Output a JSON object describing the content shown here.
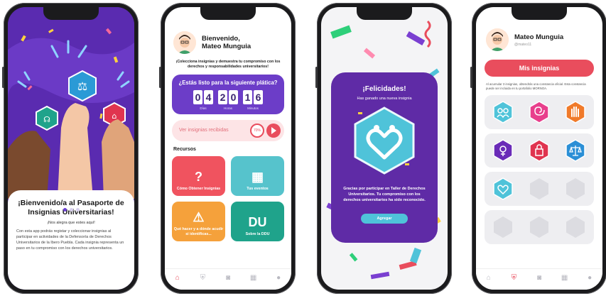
{
  "colors": {
    "purple": "#5a2bb0",
    "red": "#e94d5d",
    "teal": "#56c3cc",
    "orange": "#f5a13b",
    "green": "#1fa38b"
  },
  "onboarding": {
    "title": "¡Bienvenido/a al Pasaporte de Insignias Universitarias!",
    "subtitle": "¡Nos alegra que estes aquí!",
    "body": "Con esta app podrás registar y coleccionar insignias al participar en actividades de la Defensoría de Derechos Universitarios de la Ibero Puebla. Cada insignia representa un paso en tu compromiso con los derechos universitarios.",
    "page_dots": 3,
    "active_dot": 0
  },
  "home": {
    "greeting": "Bienvenido,\nMateo Munguia",
    "tagline": "¡Colecciona insignias y demuestra tu compromiso con los derechos y responsabilidades universitarios!",
    "countdown": {
      "question": "¿Estás listo para la siguiente plática?",
      "days": [
        "0",
        "4"
      ],
      "hours": [
        "2",
        "0"
      ],
      "minutes": [
        "1",
        "6"
      ],
      "days_label": "Días",
      "hours_label": "Horas",
      "minutes_label": "Minutos"
    },
    "progress_label": "Ver insignias recibidas",
    "progress_value": "70%",
    "resources_title": "Recursos",
    "resources": [
      {
        "label": "Cómo Obtener Insignias",
        "icon": "question-icon",
        "glyph": "?"
      },
      {
        "label": "Tus eventos",
        "icon": "calendar-icon",
        "glyph": "▦"
      },
      {
        "label": "Qué hacer y a dónde acudir si identificas...",
        "icon": "warning-icon",
        "glyph": "⚠"
      },
      {
        "label": "Sobre la DDU",
        "icon": "ddu-logo-icon",
        "glyph": "DU"
      }
    ]
  },
  "congrats": {
    "title": "¡Felicidades!",
    "subtitle": "Has ganado una nueva insignia",
    "message": "Gracias por participar en Taller de Derechos Universitarios. Tu compromiso con los derechos universitarios ha sido reconocido.",
    "button": "Agregar"
  },
  "profile": {
    "name": "Mateo Munguia",
    "handle": "@mateo11",
    "my_badges_button": "Mis insignias",
    "note": "Al acumular 3 insignias, obtendrás una constancia oficial. Esta constancia puede ser incluida en tu portafolio MORNOA.",
    "badge_rows": [
      [
        "people-badge",
        "spiral-badge",
        "hand-badge"
      ],
      [
        "gender-badge",
        "lock-badge",
        "scales-badge"
      ],
      [
        "heart-badge",
        "locked-badge",
        "locked-badge"
      ],
      [
        "locked-badge",
        "locked-badge",
        "locked-badge"
      ]
    ]
  },
  "tabbar": [
    "home-icon",
    "shield-icon",
    "camera-icon",
    "calendar-icon",
    "user-icon"
  ]
}
